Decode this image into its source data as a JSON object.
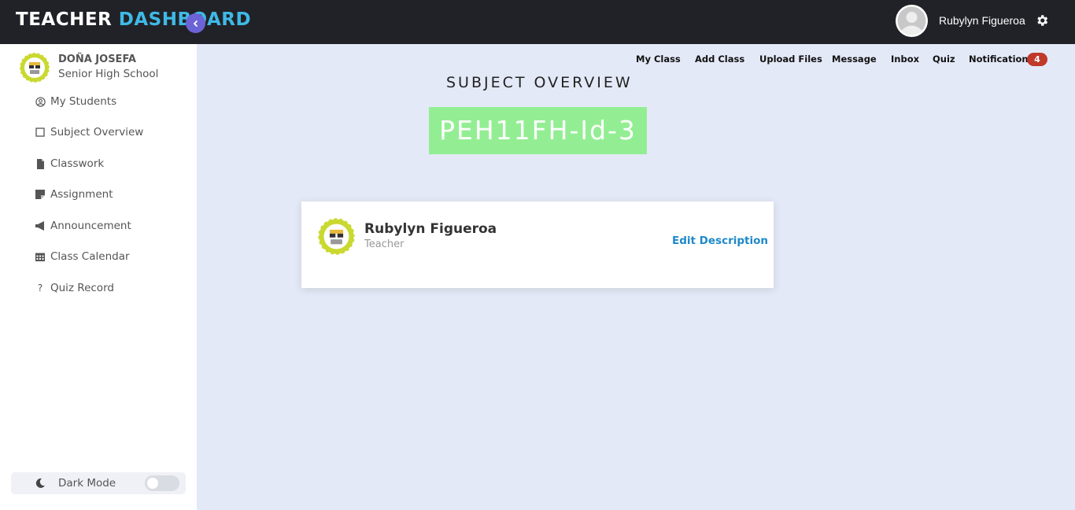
{
  "header": {
    "brand_main": "TEACHER",
    "brand_accent": "DASHBOARD",
    "user_name": "Rubylyn Figueroa",
    "accent_color": "#3fb9e6"
  },
  "sidebar": {
    "school_line1": "DOÑA JOSEFA",
    "school_line2": "Senior High School",
    "items": [
      {
        "label": "My Students",
        "icon": "user-circle-icon"
      },
      {
        "label": "Subject Overview",
        "icon": "square-icon"
      },
      {
        "label": "Classwork",
        "icon": "file-icon"
      },
      {
        "label": "Assignment",
        "icon": "sticky-note-icon"
      },
      {
        "label": "Announcement",
        "icon": "megaphone-icon"
      },
      {
        "label": "Class Calendar",
        "icon": "calendar-icon"
      },
      {
        "label": "Quiz Record",
        "icon": "question-icon"
      }
    ],
    "dark_mode_label": "Dark Mode",
    "dark_mode_on": false
  },
  "topnav": {
    "links": [
      "My Class",
      "Add Class",
      "Upload Files",
      "Message",
      "Inbox",
      "Quiz",
      "Notification"
    ],
    "notification_count": "4",
    "badge_color": "#c0392b"
  },
  "main": {
    "title": "SUBJECT OVERVIEW",
    "subject_code": "PEH11FH-Id-3",
    "subject_code_bg": "#93ee93",
    "teacher_card": {
      "name": "Rubylyn Figueroa",
      "role": "Teacher",
      "edit_label": "Edit Description"
    }
  }
}
